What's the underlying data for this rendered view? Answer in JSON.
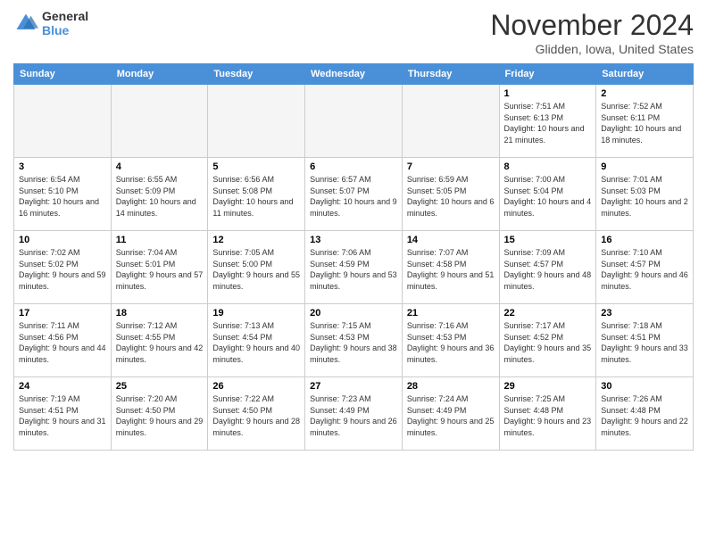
{
  "header": {
    "logo_general": "General",
    "logo_blue": "Blue",
    "month_title": "November 2024",
    "location": "Glidden, Iowa, United States"
  },
  "days_of_week": [
    "Sunday",
    "Monday",
    "Tuesday",
    "Wednesday",
    "Thursday",
    "Friday",
    "Saturday"
  ],
  "weeks": [
    [
      {
        "num": "",
        "empty": true
      },
      {
        "num": "",
        "empty": true
      },
      {
        "num": "",
        "empty": true
      },
      {
        "num": "",
        "empty": true
      },
      {
        "num": "",
        "empty": true
      },
      {
        "num": "1",
        "sunrise": "7:51 AM",
        "sunset": "6:13 PM",
        "daylight": "10 hours and 21 minutes."
      },
      {
        "num": "2",
        "sunrise": "7:52 AM",
        "sunset": "6:11 PM",
        "daylight": "10 hours and 18 minutes."
      }
    ],
    [
      {
        "num": "3",
        "sunrise": "6:54 AM",
        "sunset": "5:10 PM",
        "daylight": "10 hours and 16 minutes."
      },
      {
        "num": "4",
        "sunrise": "6:55 AM",
        "sunset": "5:09 PM",
        "daylight": "10 hours and 14 minutes."
      },
      {
        "num": "5",
        "sunrise": "6:56 AM",
        "sunset": "5:08 PM",
        "daylight": "10 hours and 11 minutes."
      },
      {
        "num": "6",
        "sunrise": "6:57 AM",
        "sunset": "5:07 PM",
        "daylight": "10 hours and 9 minutes."
      },
      {
        "num": "7",
        "sunrise": "6:59 AM",
        "sunset": "5:05 PM",
        "daylight": "10 hours and 6 minutes."
      },
      {
        "num": "8",
        "sunrise": "7:00 AM",
        "sunset": "5:04 PM",
        "daylight": "10 hours and 4 minutes."
      },
      {
        "num": "9",
        "sunrise": "7:01 AM",
        "sunset": "5:03 PM",
        "daylight": "10 hours and 2 minutes."
      }
    ],
    [
      {
        "num": "10",
        "sunrise": "7:02 AM",
        "sunset": "5:02 PM",
        "daylight": "9 hours and 59 minutes."
      },
      {
        "num": "11",
        "sunrise": "7:04 AM",
        "sunset": "5:01 PM",
        "daylight": "9 hours and 57 minutes."
      },
      {
        "num": "12",
        "sunrise": "7:05 AM",
        "sunset": "5:00 PM",
        "daylight": "9 hours and 55 minutes."
      },
      {
        "num": "13",
        "sunrise": "7:06 AM",
        "sunset": "4:59 PM",
        "daylight": "9 hours and 53 minutes."
      },
      {
        "num": "14",
        "sunrise": "7:07 AM",
        "sunset": "4:58 PM",
        "daylight": "9 hours and 51 minutes."
      },
      {
        "num": "15",
        "sunrise": "7:09 AM",
        "sunset": "4:57 PM",
        "daylight": "9 hours and 48 minutes."
      },
      {
        "num": "16",
        "sunrise": "7:10 AM",
        "sunset": "4:57 PM",
        "daylight": "9 hours and 46 minutes."
      }
    ],
    [
      {
        "num": "17",
        "sunrise": "7:11 AM",
        "sunset": "4:56 PM",
        "daylight": "9 hours and 44 minutes."
      },
      {
        "num": "18",
        "sunrise": "7:12 AM",
        "sunset": "4:55 PM",
        "daylight": "9 hours and 42 minutes."
      },
      {
        "num": "19",
        "sunrise": "7:13 AM",
        "sunset": "4:54 PM",
        "daylight": "9 hours and 40 minutes."
      },
      {
        "num": "20",
        "sunrise": "7:15 AM",
        "sunset": "4:53 PM",
        "daylight": "9 hours and 38 minutes."
      },
      {
        "num": "21",
        "sunrise": "7:16 AM",
        "sunset": "4:53 PM",
        "daylight": "9 hours and 36 minutes."
      },
      {
        "num": "22",
        "sunrise": "7:17 AM",
        "sunset": "4:52 PM",
        "daylight": "9 hours and 35 minutes."
      },
      {
        "num": "23",
        "sunrise": "7:18 AM",
        "sunset": "4:51 PM",
        "daylight": "9 hours and 33 minutes."
      }
    ],
    [
      {
        "num": "24",
        "sunrise": "7:19 AM",
        "sunset": "4:51 PM",
        "daylight": "9 hours and 31 minutes."
      },
      {
        "num": "25",
        "sunrise": "7:20 AM",
        "sunset": "4:50 PM",
        "daylight": "9 hours and 29 minutes."
      },
      {
        "num": "26",
        "sunrise": "7:22 AM",
        "sunset": "4:50 PM",
        "daylight": "9 hours and 28 minutes."
      },
      {
        "num": "27",
        "sunrise": "7:23 AM",
        "sunset": "4:49 PM",
        "daylight": "9 hours and 26 minutes."
      },
      {
        "num": "28",
        "sunrise": "7:24 AM",
        "sunset": "4:49 PM",
        "daylight": "9 hours and 25 minutes."
      },
      {
        "num": "29",
        "sunrise": "7:25 AM",
        "sunset": "4:48 PM",
        "daylight": "9 hours and 23 minutes."
      },
      {
        "num": "30",
        "sunrise": "7:26 AM",
        "sunset": "4:48 PM",
        "daylight": "9 hours and 22 minutes."
      }
    ]
  ]
}
